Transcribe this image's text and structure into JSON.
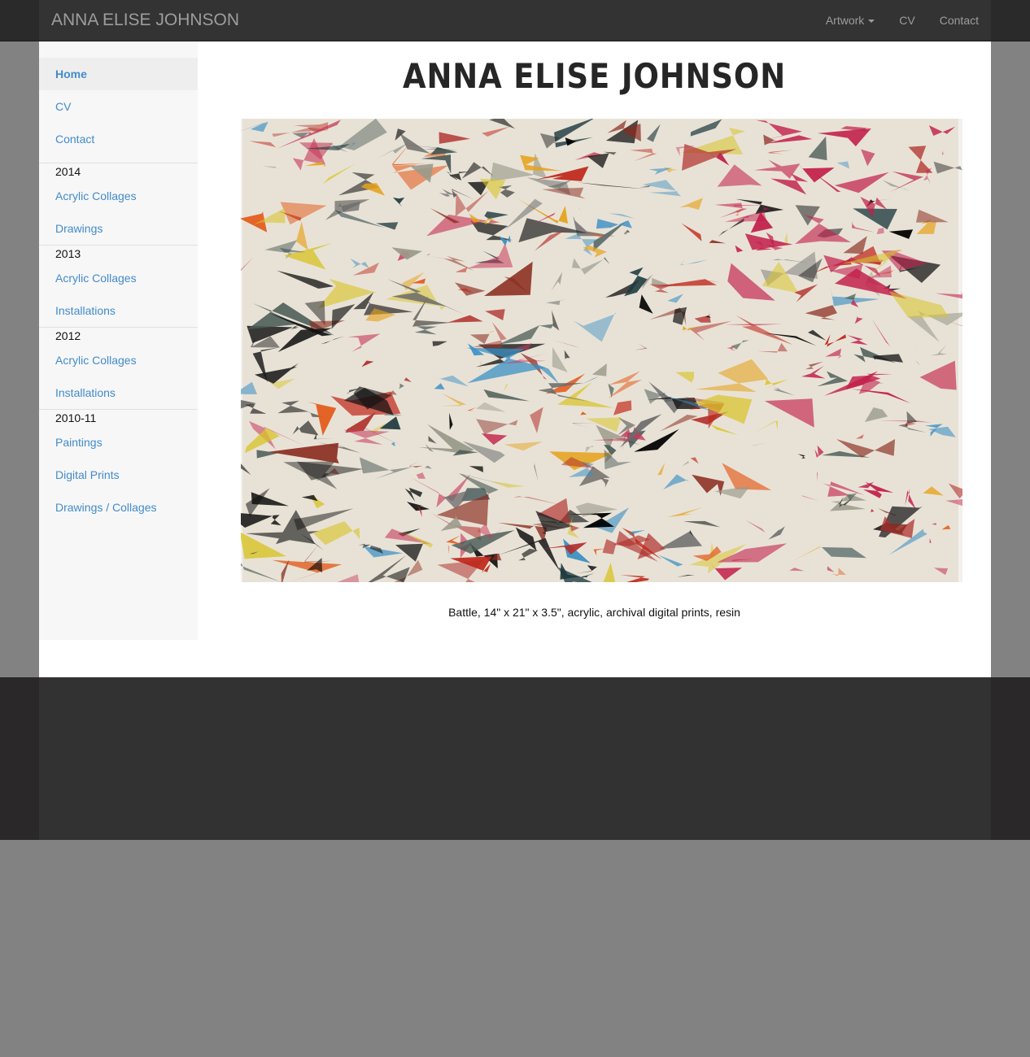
{
  "navbar": {
    "brand": "ANNA ELISE JOHNSON",
    "links": [
      {
        "label": "Artwork"
      },
      {
        "label": "CV"
      },
      {
        "label": "Contact"
      }
    ]
  },
  "sidebar": {
    "top_items": [
      {
        "label": "Home",
        "active": true
      },
      {
        "label": "CV"
      },
      {
        "label": "Contact"
      }
    ],
    "groups": [
      {
        "heading": "2014",
        "items": [
          "Acrylic Collages",
          "Drawings"
        ]
      },
      {
        "heading": "2013",
        "items": [
          "Acrylic Collages",
          "Installations"
        ]
      },
      {
        "heading": "2012",
        "items": [
          "Acrylic Collages",
          "Installations"
        ]
      },
      {
        "heading": "2010-11",
        "items": [
          "Paintings",
          "Digital Prints",
          "Drawings / Collages"
        ]
      }
    ]
  },
  "main": {
    "title": "ANNA ELISE JOHNSON",
    "caption": "Battle, 14\" x 21\" x 3.5\", acrylic, archival digital prints, resin"
  },
  "colors": {
    "link": "#428bca",
    "navbar": "#333333",
    "page_background": "#828282"
  }
}
